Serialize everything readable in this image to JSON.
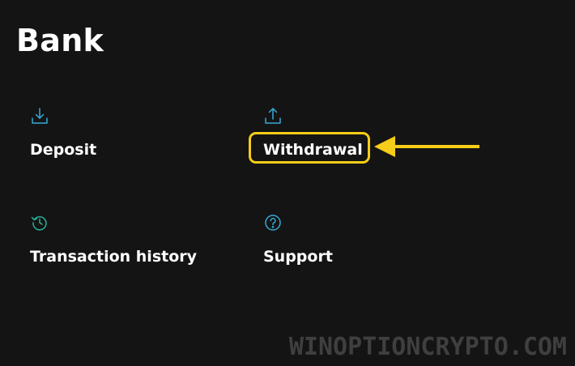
{
  "page": {
    "title": "Bank"
  },
  "cards": [
    {
      "label": "Deposit",
      "icon": "download-icon",
      "icon_color": "#36a9d6"
    },
    {
      "label": "Withdrawal",
      "icon": "upload-icon",
      "icon_color": "#36a9d6"
    },
    {
      "label": "Transaction history",
      "icon": "history-icon",
      "icon_color": "#27b29b"
    },
    {
      "label": "Support",
      "icon": "help-circle-icon",
      "icon_color": "#36a9d6"
    }
  ],
  "annotation": {
    "highlight_color": "#f6cd18",
    "highlighted_item": "Withdrawal"
  },
  "watermark": {
    "text": "WINOPTIONCRYPTO.COM"
  }
}
